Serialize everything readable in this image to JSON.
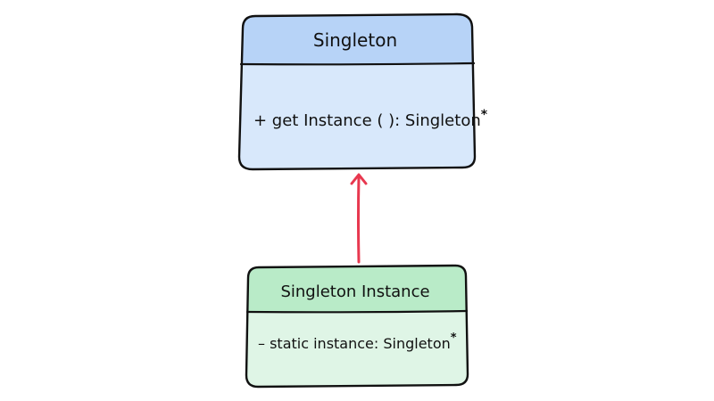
{
  "colors": {
    "background": "#ffffff",
    "stroke": "#111111",
    "arrow": "#e8384f",
    "singleton_header": "#b7d3f7",
    "singleton_body": "#d8e8fb",
    "instance_header": "#b9ebc8",
    "instance_body": "#dff5e6"
  },
  "singleton_class": {
    "name": "Singleton",
    "methods": [
      {
        "text": "+ get Instance ( ): Singleton",
        "suffix": "*"
      }
    ]
  },
  "instance_class": {
    "name": "Singleton Instance",
    "attributes": [
      {
        "text": "– static instance: Singleton",
        "suffix": "*"
      }
    ]
  },
  "relation": {
    "from": "instance_class",
    "to": "singleton_class",
    "type": "arrow"
  }
}
